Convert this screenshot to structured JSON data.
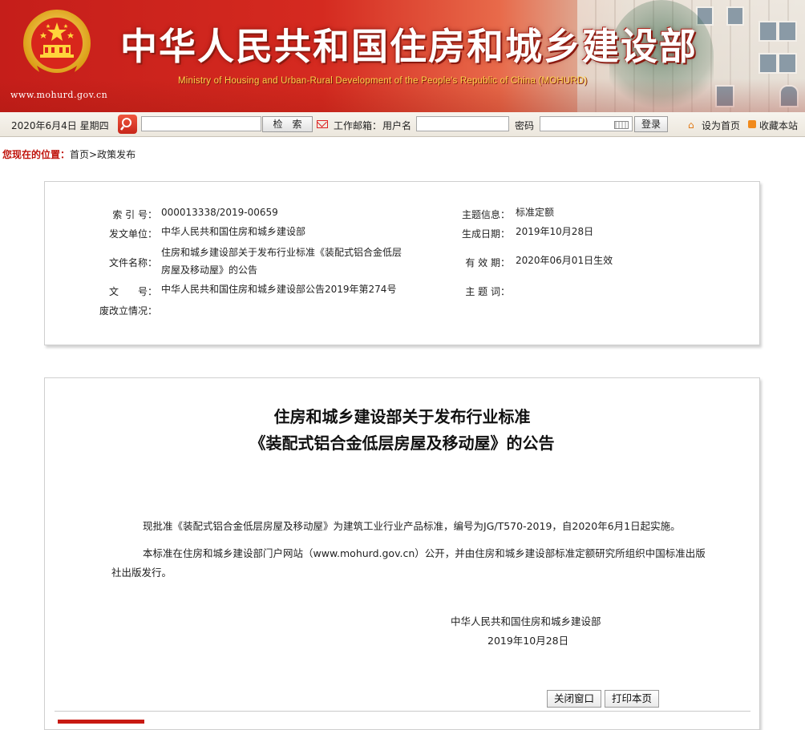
{
  "banner": {
    "url": "www.mohurd.gov.cn",
    "title_cn": "中华人民共和国住房和城乡建设部",
    "title_en": "Ministry of Housing and Urban-Rural Development of the People's Republic of China (MOHURD)"
  },
  "toolbar": {
    "date": "2020年6月4日 星期四",
    "search_button": "检　索",
    "mail_label": "工作邮箱：",
    "username_label": "用户名",
    "password_label": "密码",
    "login_button": "登录",
    "set_home": "设为首页",
    "bookmark": "收藏本站"
  },
  "location": {
    "label": "您现在的位置：",
    "home": "首页",
    "sep": ">",
    "section": "政策发布"
  },
  "info": {
    "index_label": "索 引 号：",
    "index_value": "000013338/2019-00659",
    "issuer_label": "发文单位：",
    "issuer_value": "中华人民共和国住房和城乡建设部",
    "docname_label": "文件名称：",
    "docname_value_1": "住房和城乡建设部关于发布行业标准《装配式铝合金低层",
    "docname_value_2": "房屋及移动屋》的公告",
    "docno_label": "文　　号：",
    "docno_value": "中华人民共和国住房和城乡建设部公告2019年第274号",
    "abolish_label": "废改立情况：",
    "topic_label": "主题信息：",
    "topic_value": "标准定额",
    "created_label": "生成日期：",
    "created_value": "2019年10月28日",
    "valid_label": "有 效 期：",
    "valid_value": "2020年06月01日生效",
    "keywords_label": "主 题 词："
  },
  "article": {
    "title_1": "住房和城乡建设部关于发布行业标准",
    "title_2": "《装配式铝合金低层房屋及移动屋》的公告",
    "para_1": "现批准《装配式铝合金低层房屋及移动屋》为建筑工业行业产品标准，编号为JG/T570-2019，自2020年6月1日起实施。",
    "para_2_line_1": "本标准在住房和城乡建设部门户网站（www.mohurd.gov.cn）公开，并由住房和城乡建设部标准定额研究所组织中国标准出版",
    "para_2_line_2": "社出版发行。",
    "signer": "中华人民共和国住房和城乡建设部",
    "sign_date": "2019年10月28日",
    "close_button": "关闭窗口",
    "print_button": "打印本页"
  }
}
